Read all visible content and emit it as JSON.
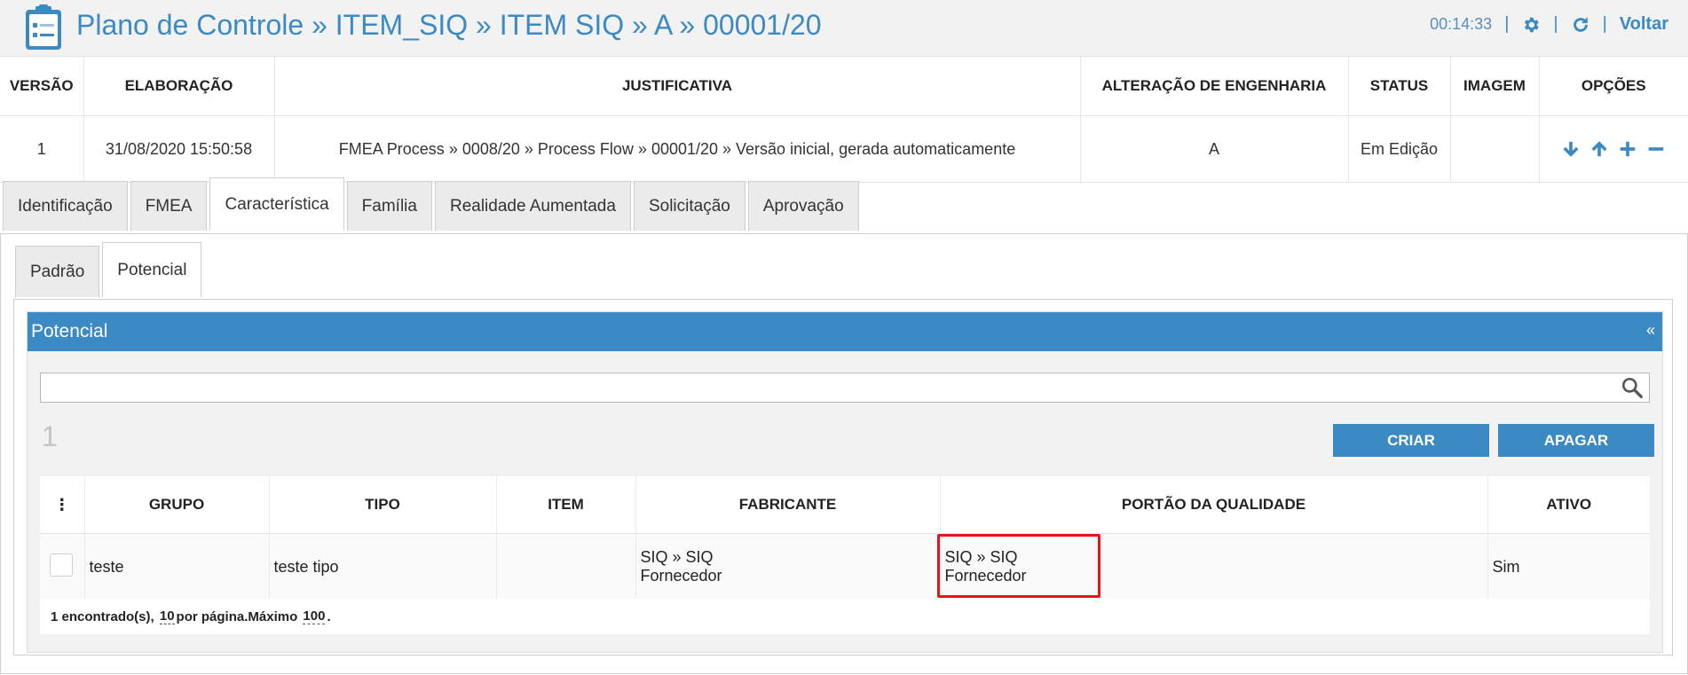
{
  "header": {
    "breadcrumb": "Plano de Controle » ITEM_SIQ » ITEM SIQ » A » 00001/20",
    "timer": "00:14:33",
    "separator": "|",
    "back_label": "Voltar",
    "icons": [
      "clipboard-icon",
      "gear-icon",
      "refresh-icon"
    ]
  },
  "version_table": {
    "columns": [
      "VERSÃO",
      "ELABORAÇÃO",
      "JUSTIFICATIVA",
      "ALTERAÇÃO DE ENGENHARIA",
      "STATUS",
      "IMAGEM",
      "OPÇÕES"
    ],
    "row": {
      "version": "1",
      "elaboration": "31/08/2020 15:50:58",
      "justification": "FMEA Process » 0008/20 » Process Flow » 00001/20 » Versão inicial, gerada automaticamente",
      "engineering_change": "A",
      "status": "Em Edição",
      "image": ""
    },
    "option_icons": [
      "arrow-down-icon",
      "arrow-up-icon",
      "plus-icon",
      "minus-icon"
    ]
  },
  "tabs": [
    "Identificação",
    "FMEA",
    "Característica",
    "Família",
    "Realidade Aumentada",
    "Solicitação",
    "Aprovação"
  ],
  "active_tab": "Característica",
  "subtabs": [
    "Padrão",
    "Potencial"
  ],
  "active_subtab": "Potencial",
  "section": {
    "title": "Potencial",
    "collapse_label": "«",
    "search_placeholder": "",
    "count": "1",
    "create_label": "CRIAR",
    "delete_label": "APAGAR"
  },
  "grid": {
    "menu_label": "⋮",
    "columns": [
      "GRUPO",
      "TIPO",
      "ITEM",
      "FABRICANTE",
      "PORTÃO DA QUALIDADE",
      "ATIVO"
    ],
    "rows": [
      {
        "grupo": "teste",
        "tipo": "teste tipo",
        "item": "",
        "fabricante_1": "SIQ » SIQ",
        "fabricante_2": "Fornecedor",
        "portao_1": "SIQ » SIQ",
        "portao_2": "Fornecedor",
        "ativo": "Sim"
      }
    ],
    "footer": {
      "found": "1 encontrado(s),",
      "per_page_value": "10",
      "per_page_text": "por página.Máximo",
      "max_value": "100",
      "end": "."
    }
  },
  "colors": {
    "accent": "#3b8ac4",
    "highlight_border": "#e8141c"
  }
}
